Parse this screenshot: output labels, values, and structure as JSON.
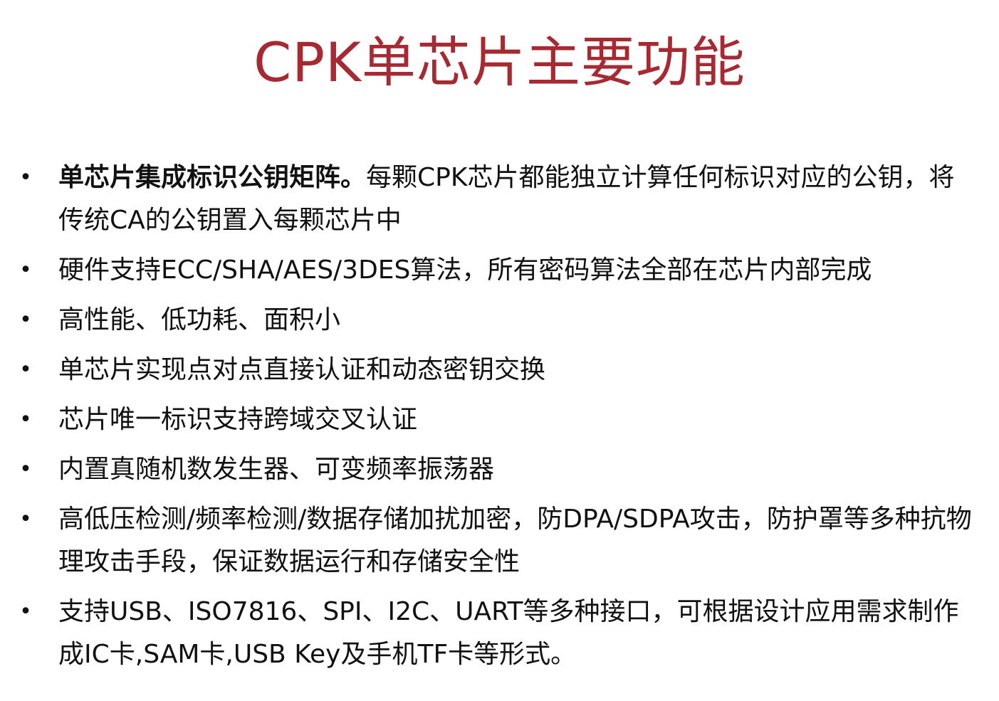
{
  "title": "CPK单芯片主要功能",
  "bullet_symbol": "•",
  "bullets": [
    {
      "bold": "单芯片集成标识公钥矩阵。",
      "text": "每颗CPK芯片都能独立计算任何标识对应的公钥，将传统CA的公钥置入每颗芯片中"
    },
    {
      "bold": "",
      "text": "硬件支持ECC/SHA/AES/3DES算法，所有密码算法全部在芯片内部完成"
    },
    {
      "bold": "",
      "text": "高性能、低功耗、面积小"
    },
    {
      "bold": "",
      "text": "单芯片实现点对点直接认证和动态密钥交换"
    },
    {
      "bold": "",
      "text": "芯片唯一标识支持跨域交叉认证"
    },
    {
      "bold": "",
      "text": "内置真随机数发生器、可变频率振荡器"
    },
    {
      "bold": "",
      "text": "高低压检测/频率检测/数据存储加扰加密，防DPA/SDPA攻击，防护罩等多种抗物理攻击手段，保证数据运行和存储安全性"
    },
    {
      "bold": "",
      "text": "支持USB、ISO7816、SPI、I2C、UART等多种接口，可根据设计应用需求制作成IC卡,SAM卡,USB Key及手机TF卡等形式。"
    }
  ]
}
